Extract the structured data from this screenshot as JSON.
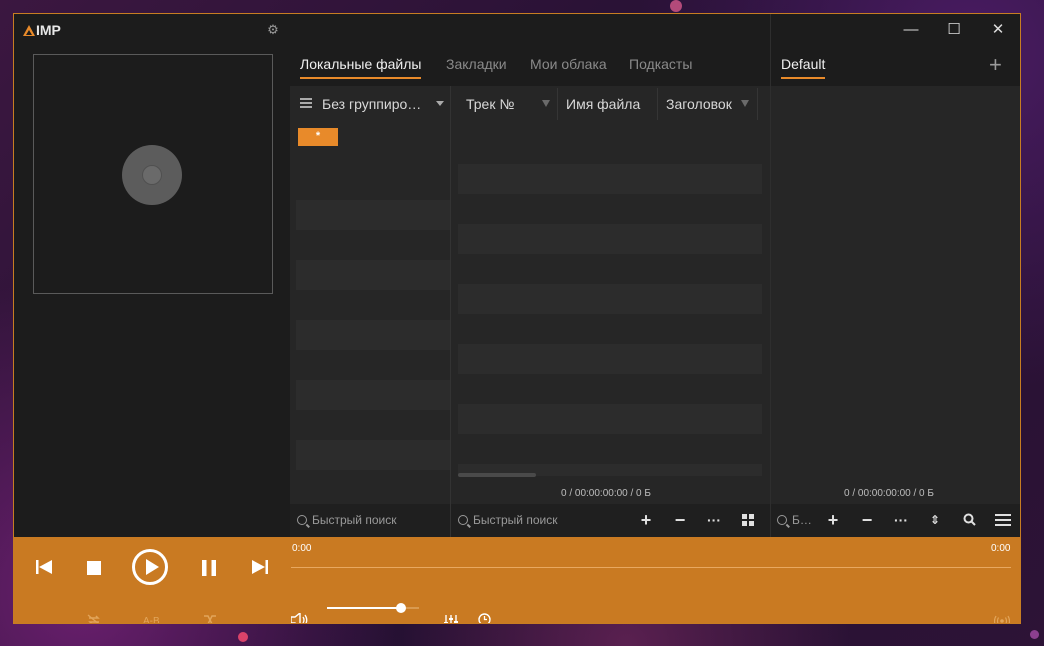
{
  "app": {
    "logo": "IMP",
    "settings_icon": "gear-icon"
  },
  "window_controls": {
    "minimize": "—",
    "maximize": "☐",
    "close": "✕"
  },
  "tabs": [
    {
      "label": "Локальные файлы",
      "active": true
    },
    {
      "label": "Закладки",
      "active": false
    },
    {
      "label": "Мои облака",
      "active": false
    },
    {
      "label": "Подкасты",
      "active": false
    }
  ],
  "group_panel": {
    "title": "Без группиро…",
    "item": "*"
  },
  "columns": [
    {
      "label": "Трек №"
    },
    {
      "label": "Имя файла"
    },
    {
      "label": "Заголовок"
    }
  ],
  "library_status": "0 / 00:00:00:00 / 0 Б",
  "search": {
    "group_placeholder": "Быстрый поиск",
    "tracks_placeholder": "Быстрый поиск",
    "playlist_placeholder": "Б…"
  },
  "playlist": {
    "tab_label": "Default",
    "status": "0 / 00:00:00:00 / 0 Б"
  },
  "player": {
    "time_elapsed": "0:00",
    "time_total": "0:00",
    "ab_label": "A-B",
    "volume": 0.8
  },
  "colors": {
    "accent": "#e88a2a",
    "player_bg": "#c97a22",
    "panel_bg": "#262626"
  }
}
